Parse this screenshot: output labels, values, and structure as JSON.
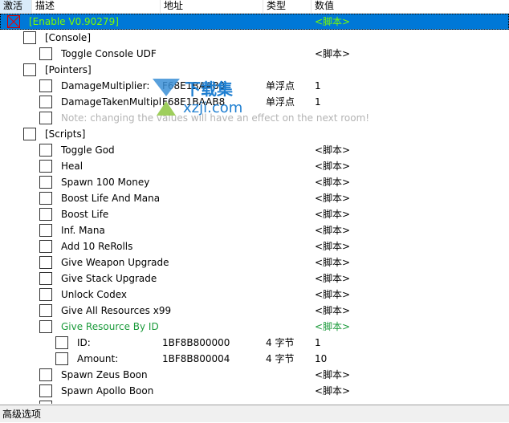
{
  "header": {
    "active": "激活",
    "description": "描述",
    "address": "地址",
    "type": "类型",
    "value": "数值"
  },
  "rows": [
    {
      "level": 0,
      "desc": "[Enable V0.90279]",
      "addr": "",
      "type": "",
      "value": "<脚本>",
      "color": "#7cfc00",
      "selected": true,
      "checked": true
    },
    {
      "level": 1,
      "desc": "[Console]",
      "addr": "",
      "type": "",
      "value": ""
    },
    {
      "level": 2,
      "desc": "Toggle Console UDF",
      "addr": "",
      "type": "",
      "value": "<脚本>"
    },
    {
      "level": 1,
      "desc": "[Pointers]",
      "addr": "",
      "type": "",
      "value": ""
    },
    {
      "level": 2,
      "desc": "DamageMultiplier:",
      "addr": "F68E1BAAB8",
      "type": "单浮点",
      "value": "1"
    },
    {
      "level": 2,
      "desc": "DamageTakenMultipl",
      "addr": "F68E1BAAB8",
      "type": "单浮点",
      "value": "1"
    },
    {
      "level": 2,
      "desc": "Note: changing the values will have an effect on the next room!",
      "addr": "",
      "type": "",
      "value": "",
      "color": "#b4b4b4"
    },
    {
      "level": 1,
      "desc": "[Scripts]",
      "addr": "",
      "type": "",
      "value": ""
    },
    {
      "level": 2,
      "desc": "Toggle God",
      "addr": "",
      "type": "",
      "value": "<脚本>"
    },
    {
      "level": 2,
      "desc": "Heal",
      "addr": "",
      "type": "",
      "value": "<脚本>"
    },
    {
      "level": 2,
      "desc": "Spawn 100 Money",
      "addr": "",
      "type": "",
      "value": "<脚本>"
    },
    {
      "level": 2,
      "desc": "Boost Life And Mana",
      "addr": "",
      "type": "",
      "value": "<脚本>"
    },
    {
      "level": 2,
      "desc": "Boost Life",
      "addr": "",
      "type": "",
      "value": "<脚本>"
    },
    {
      "level": 2,
      "desc": "Inf. Mana",
      "addr": "",
      "type": "",
      "value": "<脚本>"
    },
    {
      "level": 2,
      "desc": "Add 10 ReRolls",
      "addr": "",
      "type": "",
      "value": "<脚本>"
    },
    {
      "level": 2,
      "desc": "Give Weapon Upgrade",
      "addr": "",
      "type": "",
      "value": "<脚本>"
    },
    {
      "level": 2,
      "desc": "Give Stack Upgrade",
      "addr": "",
      "type": "",
      "value": "<脚本>"
    },
    {
      "level": 2,
      "desc": "Unlock Codex",
      "addr": "",
      "type": "",
      "value": "<脚本>"
    },
    {
      "level": 2,
      "desc": "Give All Resources x99",
      "addr": "",
      "type": "",
      "value": "<脚本>"
    },
    {
      "level": 2,
      "desc": "Give Resource By ID",
      "addr": "",
      "type": "",
      "value": "<脚本>",
      "color": "#1a9a3a"
    },
    {
      "level": 3,
      "desc": "ID:",
      "addr": "1BF8B800000",
      "type": "4 字节",
      "value": "1"
    },
    {
      "level": 3,
      "desc": "Amount:",
      "addr": "1BF8B800004",
      "type": "4 字节",
      "value": "10"
    },
    {
      "level": 2,
      "desc": "Spawn Zeus Boon",
      "addr": "",
      "type": "",
      "value": "<脚本>"
    },
    {
      "level": 2,
      "desc": "Spawn Apollo Boon",
      "addr": "",
      "type": "",
      "value": "<脚本>"
    },
    {
      "level": 2,
      "desc": "",
      "addr": "",
      "type": "",
      "value": ""
    }
  ],
  "watermark": {
    "text": "下载集",
    "url": "xzji.com"
  },
  "status": {
    "advanced_options": "高级选项"
  }
}
